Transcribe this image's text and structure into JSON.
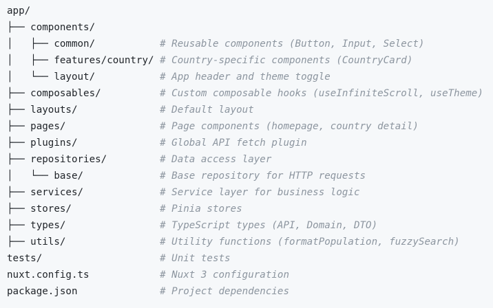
{
  "tree": {
    "lines": [
      {
        "path": "app/",
        "comment": ""
      },
      {
        "path": "├── components/",
        "comment": ""
      },
      {
        "path": "│   ├── common/           ",
        "comment": "# Reusable components (Button, Input, Select)"
      },
      {
        "path": "│   ├── features/country/ ",
        "comment": "# Country-specific components (CountryCard)"
      },
      {
        "path": "│   └── layout/           ",
        "comment": "# App header and theme toggle"
      },
      {
        "path": "├── composables/          ",
        "comment": "# Custom composable hooks (useInfiniteScroll, useTheme)"
      },
      {
        "path": "├── layouts/              ",
        "comment": "# Default layout"
      },
      {
        "path": "├── pages/                ",
        "comment": "# Page components (homepage, country detail)"
      },
      {
        "path": "├── plugins/              ",
        "comment": "# Global API fetch plugin"
      },
      {
        "path": "├── repositories/         ",
        "comment": "# Data access layer"
      },
      {
        "path": "│   └── base/             ",
        "comment": "# Base repository for HTTP requests"
      },
      {
        "path": "├── services/             ",
        "comment": "# Service layer for business logic"
      },
      {
        "path": "├── stores/               ",
        "comment": "# Pinia stores"
      },
      {
        "path": "├── types/                ",
        "comment": "# TypeScript types (API, Domain, DTO)"
      },
      {
        "path": "├── utils/                ",
        "comment": "# Utility functions (formatPopulation, fuzzySearch)"
      },
      {
        "path": "tests/                    ",
        "comment": "# Unit tests"
      },
      {
        "path": "nuxt.config.ts            ",
        "comment": "# Nuxt 3 configuration"
      },
      {
        "path": "package.json              ",
        "comment": "# Project dependencies"
      }
    ]
  }
}
